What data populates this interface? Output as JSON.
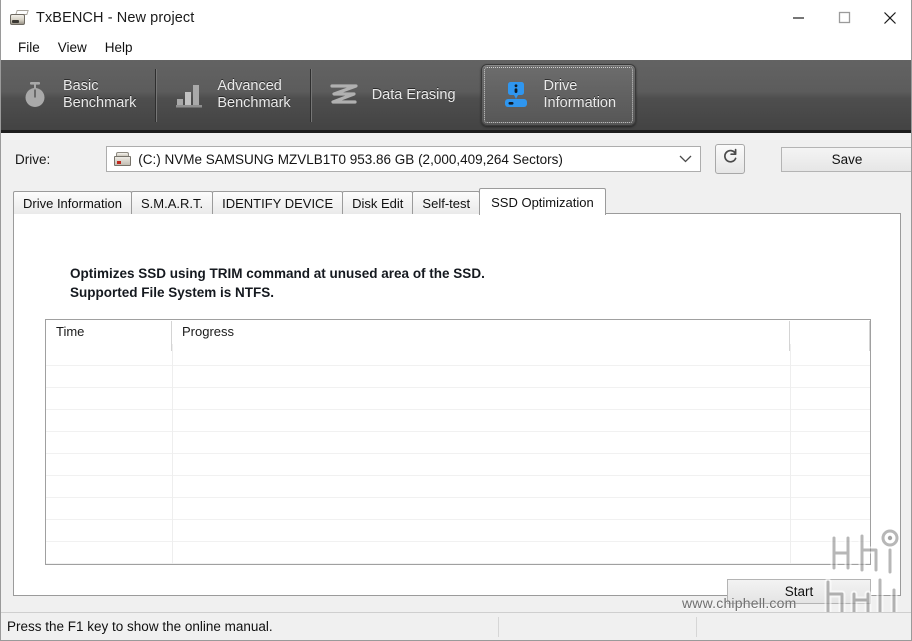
{
  "window": {
    "title": "TxBENCH - New project",
    "icon": "app-drive-icon",
    "controls": {
      "minimize": "minimize-icon",
      "maximize": "maximize-icon",
      "close": "close-icon"
    }
  },
  "menu": {
    "items": [
      "File",
      "View",
      "Help"
    ]
  },
  "toolbar": {
    "items": [
      {
        "label": "Basic\nBenchmark",
        "icon": "stopwatch-icon",
        "active": false,
        "name": "basic-benchmark"
      },
      {
        "label": "Advanced\nBenchmark",
        "icon": "bar-chart-icon",
        "active": false,
        "name": "advanced-benchmark"
      },
      {
        "label": "Data Erasing",
        "icon": "eraser-wave-icon",
        "active": false,
        "name": "data-erasing"
      },
      {
        "label": "Drive\nInformation",
        "icon": "drive-info-icon",
        "active": true,
        "name": "drive-information"
      }
    ],
    "active_accent": "#2f96ef"
  },
  "drive_row": {
    "label": "Drive:",
    "selected": "(C:) NVMe SAMSUNG MZVLB1T0  953.86 GB (2,000,409,264 Sectors)",
    "options": [
      "(C:) NVMe SAMSUNG MZVLB1T0  953.86 GB (2,000,409,264 Sectors)"
    ],
    "drive_icon": "hard-disk-icon",
    "dropdown_icon": "chevron-down-icon",
    "refresh_icon": "refresh-icon",
    "save_label": "Save"
  },
  "tabs": {
    "items": [
      {
        "label": "Drive Information",
        "active": false
      },
      {
        "label": "S.M.A.R.T.",
        "active": false
      },
      {
        "label": "IDENTIFY DEVICE",
        "active": false
      },
      {
        "label": "Disk Edit",
        "active": false
      },
      {
        "label": "Self-test",
        "active": false
      },
      {
        "label": "SSD Optimization",
        "active": true
      }
    ]
  },
  "panel": {
    "description": "Optimizes SSD using TRIM command at unused area of the SSD.\nSupported File System is NTFS.",
    "list": {
      "columns": [
        "Time",
        "Progress",
        ""
      ],
      "rows": [],
      "empty_row_count": 10
    },
    "start_label": "Start"
  },
  "watermark": {
    "url": "www.chiphell.com",
    "logo": "chiphell-logo"
  },
  "statusbar": {
    "message": "Press the F1 key to show the online manual.",
    "cell2": "",
    "cell3": ""
  }
}
